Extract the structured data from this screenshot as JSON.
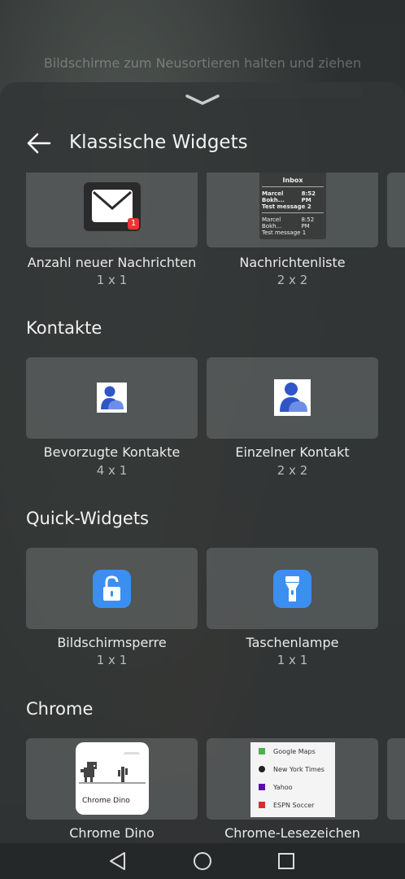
{
  "background": {
    "hint": "Bildschirme zum Neusortieren halten und ziehen"
  },
  "header": {
    "title": "Klassische Widgets"
  },
  "sections": {
    "mail": {
      "tiles": [
        {
          "name": "Anzahl neuer Nachrichten",
          "size": "1 x 1",
          "badge": "1"
        },
        {
          "name": "Nachrichtenliste",
          "size": "2 x 2",
          "preview": {
            "title": "Inbox",
            "rows": [
              {
                "sender": "Marcel Bokh...",
                "time": "8:52 PM",
                "subject": "Test message 2",
                "unread": true
              },
              {
                "sender": "Marcel Bokh...",
                "time": "8:52 PM",
                "subject": "Test message 1",
                "unread": false
              }
            ]
          }
        }
      ]
    },
    "contacts": {
      "title": "Kontakte",
      "tiles": [
        {
          "name": "Bevorzugte Kontakte",
          "size": "4 x 1"
        },
        {
          "name": "Einzelner Kontakt",
          "size": "2 x 2"
        }
      ]
    },
    "quick": {
      "title": "Quick-Widgets",
      "tiles": [
        {
          "name": "Bildschirmsperre",
          "size": "1 x 1",
          "icon": "unlock-icon"
        },
        {
          "name": "Taschenlampe",
          "size": "1 x 1",
          "icon": "flashlight-icon"
        }
      ]
    },
    "chrome": {
      "title": "Chrome",
      "tiles": [
        {
          "name": "Chrome Dino",
          "preview_label": "Chrome Dino"
        },
        {
          "name": "Chrome-Lesezeichen",
          "bookmarks": [
            "Google Maps",
            "New York Times",
            "Yahoo",
            "ESPN Soccer"
          ]
        }
      ]
    }
  },
  "colors": {
    "accent_blue": "#3b8ff0",
    "badge_red": "#e33333",
    "contact_blue": "#2f55c7"
  }
}
